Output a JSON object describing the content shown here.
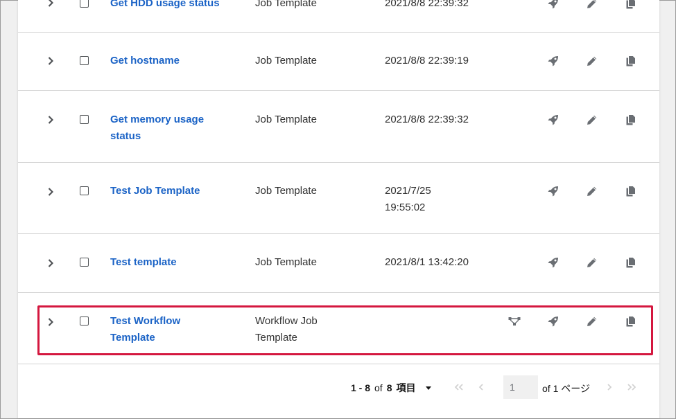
{
  "rows": [
    {
      "name": "Get HDD usage status",
      "type": "Job Template",
      "date": "2021/8/8 22:39:32"
    },
    {
      "name": "Get hostname",
      "type": "Job Template",
      "date": "2021/8/8 22:39:19"
    },
    {
      "name_l1": "Get memory usage",
      "name_l2": "status",
      "type": "Job Template",
      "date": "2021/8/8 22:39:32"
    },
    {
      "name": "Test Job Template",
      "type": "Job Template",
      "date_l1": "2021/7/25",
      "date_l2": "19:55:02"
    },
    {
      "name": "Test template",
      "type": "Job Template",
      "date": "2021/8/1 13:42:20"
    },
    {
      "name_l1": "Test Workflow",
      "name_l2": "Template",
      "type_l1": "Workflow Job",
      "type_l2": "Template",
      "date": ""
    }
  ],
  "pagination": {
    "range": "1 - 8",
    "of_label": "of",
    "total": "8",
    "items_label": "項目",
    "current_page": "1",
    "page_suffix": "of 1 ページ"
  },
  "icons": {
    "expand": "chevron-right-icon",
    "launch": "rocket-icon",
    "edit": "pencil-icon",
    "copy": "copy-icon",
    "visualizer": "workflow-visualizer-icon"
  },
  "colors": {
    "link": "#1b63c6",
    "highlight": "#d4173f",
    "icon": "#6a6e73"
  }
}
